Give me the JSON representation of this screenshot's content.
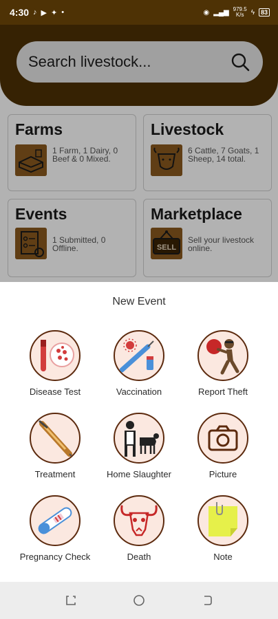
{
  "status_bar": {
    "time": "4:30",
    "icons": [
      "tiktok-icon",
      "youtube-icon",
      "twitter-icon",
      "dot-icon"
    ],
    "speed_value": "979.5",
    "speed_unit": "K/s",
    "battery": "83"
  },
  "search": {
    "placeholder": "Search livestock..."
  },
  "cards": [
    {
      "title": "Farms",
      "desc": "1 Farm, 1 Dairy, 0 Beef &  0 Mixed.",
      "icon": "farm-pen-icon"
    },
    {
      "title": "Livestock",
      "desc": "6 Cattle, 7 Goats, 1 Sheep, 14 total.",
      "icon": "cow-head-icon"
    },
    {
      "title": "Events",
      "desc": "1 Submitted, 0 Offline.",
      "icon": "checklist-icon"
    },
    {
      "title": "Marketplace",
      "desc": "Sell your livestock online.",
      "icon": "sell-sign-icon"
    }
  ],
  "sheet": {
    "title": "New Event",
    "options": [
      {
        "label": "Disease Test",
        "icon": "blood-test-icon"
      },
      {
        "label": "Vaccination",
        "icon": "syringe-vaccine-icon"
      },
      {
        "label": "Report Theft",
        "icon": "thief-icon"
      },
      {
        "label": "Treatment",
        "icon": "treatment-syringe-icon"
      },
      {
        "label": "Home Slaughter",
        "icon": "butcher-cow-icon"
      },
      {
        "label": "Picture",
        "icon": "camera-icon"
      },
      {
        "label": "Pregnancy Check",
        "icon": "pregnancy-test-icon"
      },
      {
        "label": "Death",
        "icon": "bull-skull-icon"
      },
      {
        "label": "Note",
        "icon": "sticky-note-icon"
      }
    ]
  },
  "colors": {
    "brand_brown": "#4e3205",
    "circle_border": "#5c2a0e",
    "circle_fill": "#fbe8e0"
  }
}
